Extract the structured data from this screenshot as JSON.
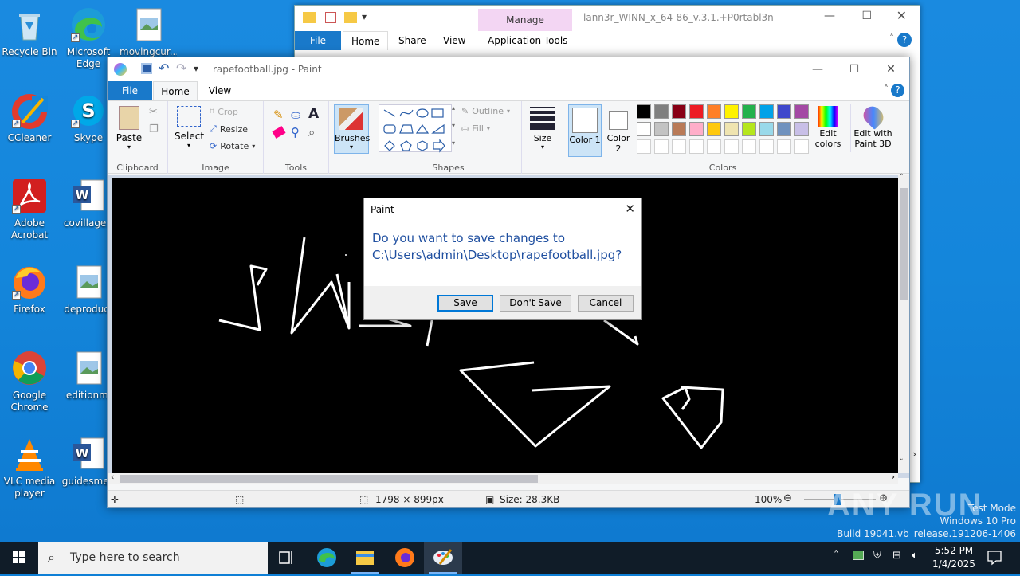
{
  "desktop": {
    "icons": [
      {
        "label": "Recycle Bin",
        "icon": "recycle-bin-icon"
      },
      {
        "label": "Microsoft Edge",
        "line1": "Microsoft",
        "line2": "Edge",
        "icon": "edge-icon"
      },
      {
        "label": "movingcur...",
        "icon": "image-file-icon"
      },
      {
        "label": "CCleaner",
        "icon": "ccleaner-icon"
      },
      {
        "label": "Skype",
        "icon": "skype-icon"
      },
      {
        "label": "Adobe Acrobat",
        "line1": "Adobe",
        "line2": "Acrobat",
        "icon": "acrobat-icon"
      },
      {
        "label": "covillage.r",
        "icon": "word-doc-icon"
      },
      {
        "label": "Firefox",
        "icon": "firefox-icon"
      },
      {
        "label": "deproduct",
        "icon": "image-file-icon"
      },
      {
        "label": "Google Chrome",
        "line1": "Google",
        "line2": "Chrome",
        "icon": "chrome-icon"
      },
      {
        "label": "editionmi",
        "icon": "image-file-icon"
      },
      {
        "label": "VLC media player",
        "line1": "VLC media",
        "line2": "player",
        "icon": "vlc-icon"
      },
      {
        "label": "guidesmed",
        "icon": "word-doc-icon"
      }
    ]
  },
  "explorer": {
    "title": "lann3r_WINN_x_64-86_v.3.1.+P0rtabl3n",
    "manage": "Manage",
    "tabs": [
      "File",
      "Home",
      "Share",
      "View",
      "Application Tools"
    ]
  },
  "paint": {
    "title": "rapefootball.jpg - Paint",
    "tabs": [
      "File",
      "Home",
      "View"
    ],
    "clipboard": {
      "paste": "Paste",
      "label": "Clipboard"
    },
    "image": {
      "select": "Select",
      "crop": "Crop",
      "resize": "Resize",
      "rotate": "Rotate",
      "label": "Image"
    },
    "tools": {
      "label": "Tools"
    },
    "brushes": "Brushes",
    "shapes": {
      "outline": "Outline",
      "fill": "Fill",
      "label": "Shapes"
    },
    "size": "Size",
    "color1": "Color 1",
    "color2": "Color 2",
    "colors_label": "Colors",
    "edit_colors": "Edit colors",
    "edit_paint3d": "Edit with Paint 3D",
    "palette": [
      "#000000",
      "#7f7f7f",
      "#880015",
      "#ed1c24",
      "#ff7f27",
      "#fff200",
      "#22b14c",
      "#00a2e8",
      "#3f48cc",
      "#a349a4",
      "#ffffff",
      "#c3c3c3",
      "#b97a57",
      "#ffaec9",
      "#ffc90e",
      "#efe4b0",
      "#b5e61d",
      "#99d9ea",
      "#7092be",
      "#c8bfe7"
    ],
    "status": {
      "dimensions": "1798 × 899px",
      "size": "Size: 28.3KB",
      "zoom": "100%"
    }
  },
  "dialog": {
    "title": "Paint",
    "message_line1": "Do you want to save changes to",
    "message_line2": "C:\\Users\\admin\\Desktop\\rapefootball.jpg?",
    "save": "Save",
    "dont_save": "Don't Save",
    "cancel": "Cancel"
  },
  "taskbar": {
    "search_placeholder": "Type here to search",
    "time": "5:52 PM",
    "date": "1/4/2025"
  },
  "watermark": {
    "logo": "ANY RUN",
    "line1": "Test Mode",
    "line2": "Windows 10 Pro",
    "line3": "Build 19041.vb_release.191206-1406"
  }
}
